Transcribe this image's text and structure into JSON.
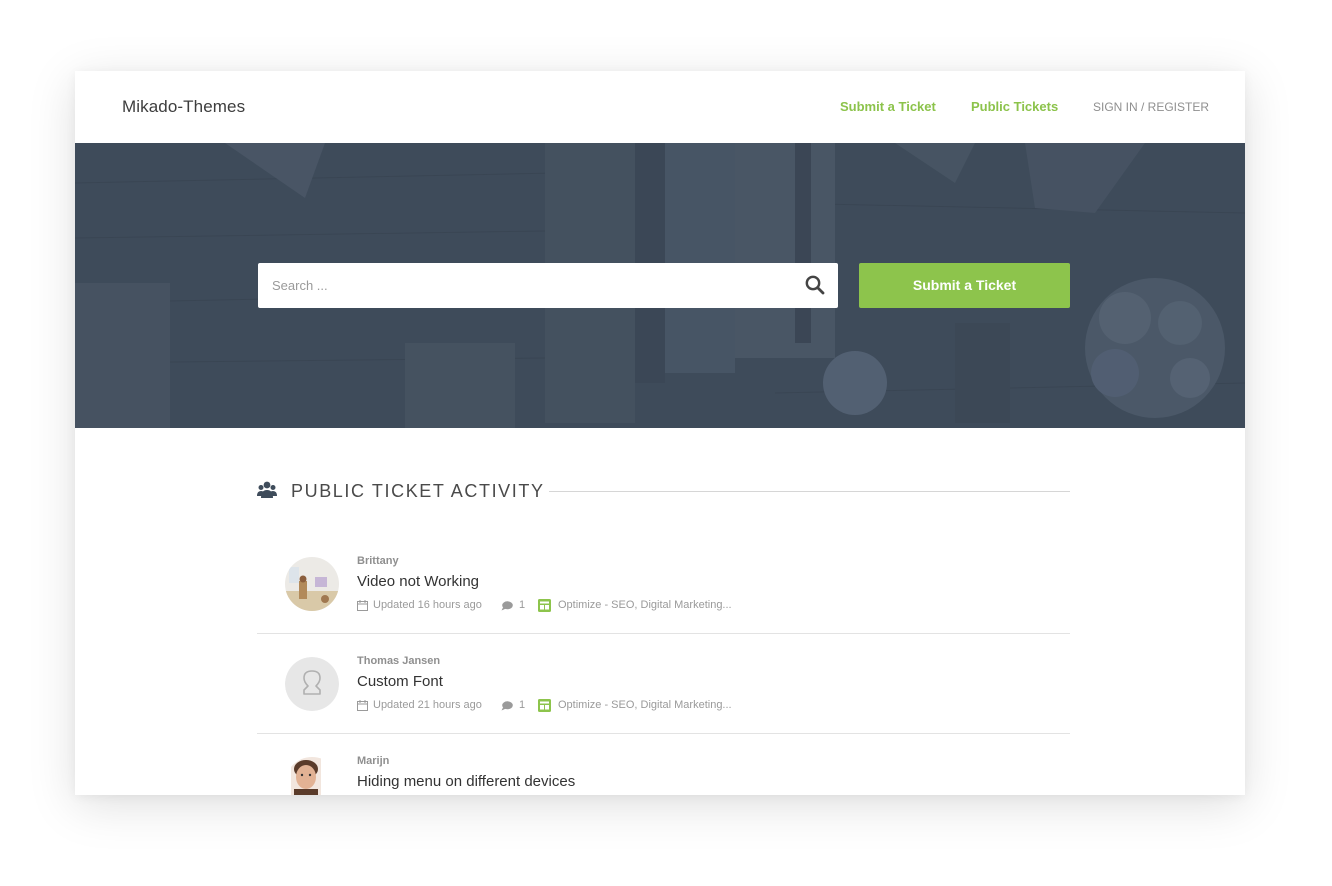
{
  "header": {
    "logo": "Mikado-Themes",
    "nav": [
      {
        "label": "Submit a Ticket"
      },
      {
        "label": "Public Tickets"
      },
      {
        "label": "SIGN IN / REGISTER"
      }
    ]
  },
  "hero": {
    "search": {
      "placeholder": "Search ...",
      "value": ""
    },
    "submit_label": "Submit a Ticket"
  },
  "section": {
    "title": "PUBLIC TICKET ACTIVITY",
    "icon": "users-icon"
  },
  "tickets": [
    {
      "author": "Brittany",
      "title": "Video not Working",
      "updated": "Updated 16 hours ago",
      "replies": "1",
      "category": "Optimize - SEO, Digital Marketing..."
    },
    {
      "author": "Thomas Jansen",
      "title": "Custom Font",
      "updated": "Updated 21 hours ago",
      "replies": "1",
      "category": "Optimize - SEO, Digital Marketing..."
    },
    {
      "author": "Marijn",
      "title": "Hiding menu on different devices"
    }
  ],
  "colors": {
    "accent": "#8dc44c",
    "hero_bg": "#3f4c5b",
    "text": "#333333",
    "muted": "#9a9a9a"
  }
}
